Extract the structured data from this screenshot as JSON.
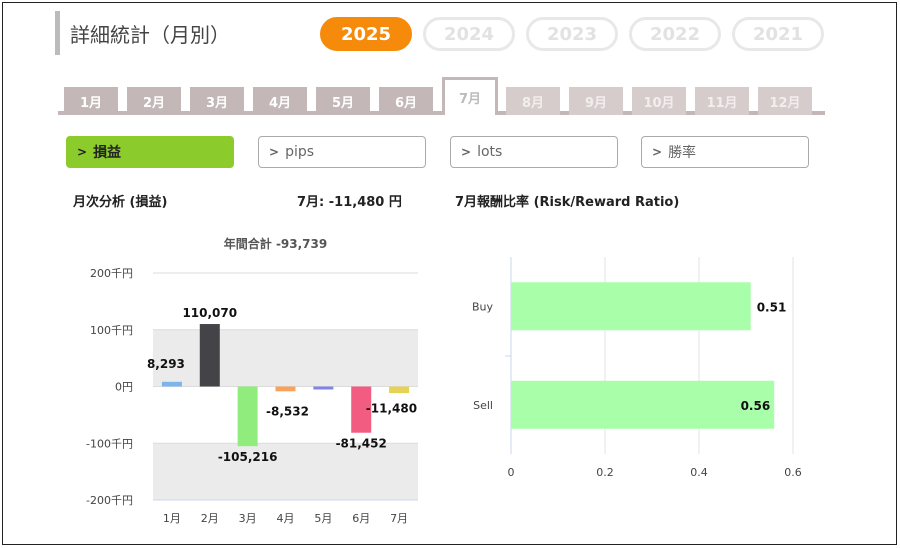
{
  "header": {
    "title": "詳細統計（月別）"
  },
  "years": [
    "2025",
    "2024",
    "2023",
    "2022",
    "2021"
  ],
  "months": [
    "1月",
    "2月",
    "3月",
    "4月",
    "5月",
    "6月",
    "7月",
    "8月",
    "9月",
    "10月",
    "11月",
    "12月"
  ],
  "active_month_index": 6,
  "metrics": [
    "損益",
    "pips",
    "lots",
    "勝率"
  ],
  "left_panel": {
    "heading": "月次分析 (損益)",
    "summary": "7月: -11,480 円"
  },
  "right_panel": {
    "heading": "7月報酬比率 (Risk/Reward Ratio)"
  },
  "colors": {
    "accent": "#f58a0b",
    "active_metric": "#8ccb2c",
    "tab": "#c3b7b7"
  },
  "chart_data": [
    {
      "type": "bar",
      "title": "年間合計 -93,739",
      "categories": [
        "1月",
        "2月",
        "3月",
        "4月",
        "5月",
        "6月",
        "7月"
      ],
      "values": [
        8293,
        110070,
        -105216,
        -8532,
        -1200,
        -81452,
        -11480
      ],
      "value_labels": [
        "8,293",
        "110,070",
        "-105,216",
        "-8,532",
        "",
        "-81,452",
        "-11,480"
      ],
      "bar_colors": [
        "#7cb5ec",
        "#434348",
        "#90ed7d",
        "#f7a35c",
        "#8085e9",
        "#f15c80",
        "#e4d354"
      ],
      "y_ticks": [
        "200千円",
        "100千円",
        "0円",
        "-100千円",
        "-200千円"
      ],
      "ylim": [
        -200000,
        200000
      ]
    },
    {
      "type": "bar",
      "orientation": "horizontal",
      "categories": [
        "Buy",
        "Sell"
      ],
      "values": [
        0.51,
        0.56
      ],
      "value_labels": [
        "0.51",
        "0.56"
      ],
      "x_ticks": [
        "0",
        "0.2",
        "0.4",
        "0.6"
      ],
      "xlim": [
        0,
        0.6
      ],
      "bar_color": "#a9ffa9"
    }
  ]
}
